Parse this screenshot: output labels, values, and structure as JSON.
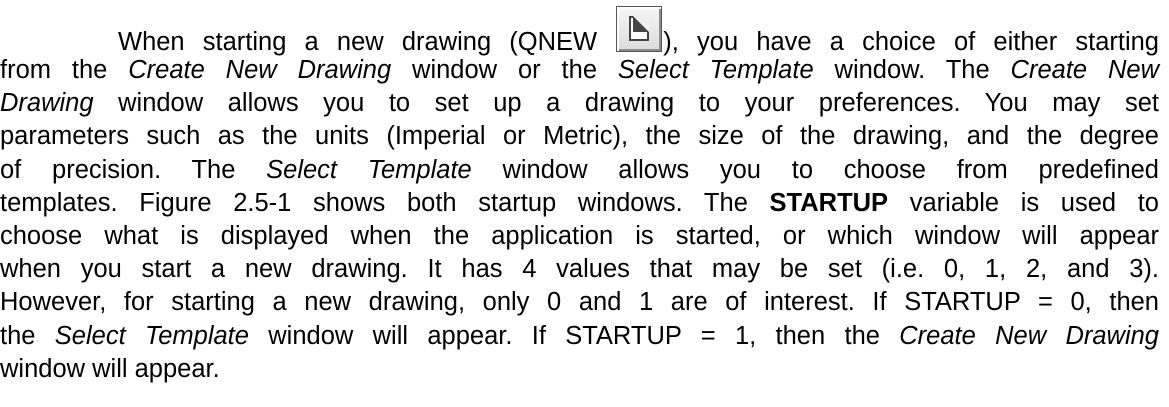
{
  "paragraph": {
    "line1": {
      "before_icon": "When starting a new drawing (QNEW ",
      "after_icon": "), you have a choice of either starting"
    },
    "line2": {
      "t1": "from the ",
      "i1": "Create New Drawing",
      "t2": " window or the ",
      "i2": "Select Template",
      "t3": " window.  The ",
      "i3": "Create New"
    },
    "line3": {
      "i1": "Drawing",
      "t1": " window allows you to set up a drawing to your preferences.  You may set"
    },
    "line4": {
      "t1": "parameters such as the units (Imperial or Metric), the size of the drawing, and the degree"
    },
    "line5": {
      "t1": "of precision.   The ",
      "i1": "Select Template",
      "t2": " window allows you to choose from predefined"
    },
    "line6": {
      "t1": "templates. Figure 2.5-1 shows both startup windows.  The ",
      "b1": "STARTUP",
      "t2": " variable is used to"
    },
    "line7": {
      "t1": "choose what is displayed when the application is started, or which window will appear"
    },
    "line8": {
      "t1": "when you start a new drawing.  It has 4 values that may be set (i.e. 0, 1, 2, and 3)."
    },
    "line9": {
      "t1": "However, for starting a new drawing, only 0 and 1 are of interest.  If STARTUP = 0, then"
    },
    "line10": {
      "t1": "the ",
      "i1": "Select Template",
      "t2": " window will appear.  If STARTUP = 1, then the ",
      "i2": "Create New Drawing"
    },
    "line11": {
      "t1": "window will appear."
    }
  },
  "icons": {
    "qnew": "new-drawing-icon"
  }
}
